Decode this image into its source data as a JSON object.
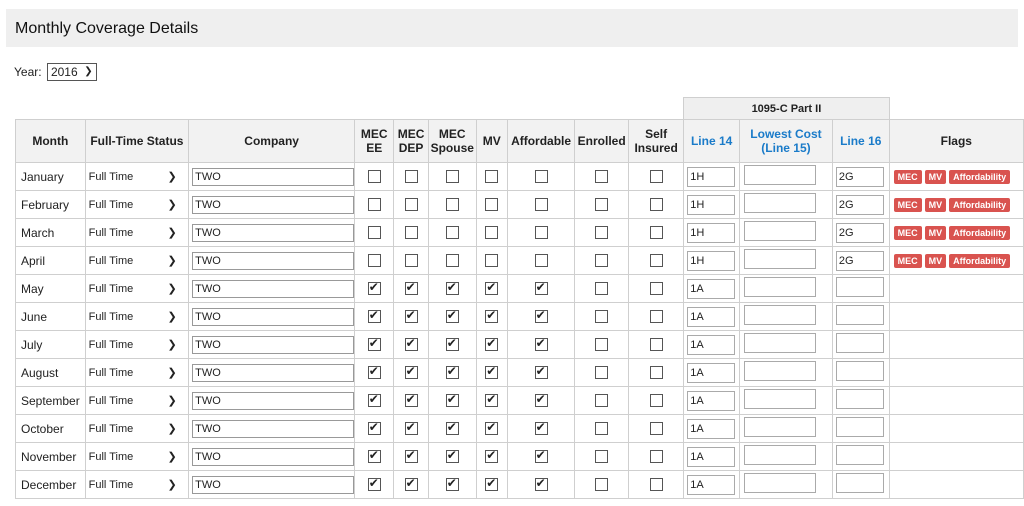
{
  "page": {
    "title": "Monthly Coverage Details"
  },
  "year": {
    "label": "Year:",
    "value": "2016"
  },
  "table": {
    "group_header": "1095-C Part II",
    "columns": {
      "month": "Month",
      "status": "Full-Time Status",
      "company": "Company",
      "mec_ee": "MEC EE",
      "mec_dep": "MEC DEP",
      "mec_spouse": "MEC Spouse",
      "mv": "MV",
      "affordable": "Affordable",
      "enrolled": "Enrolled",
      "self_insured": "Self Insured",
      "line14": "Line 14",
      "line15": "Lowest Cost (Line 15)",
      "line16": "Line 16",
      "flags": "Flags"
    },
    "rows": [
      {
        "month": "January",
        "status": "Full Time",
        "company": "TWO",
        "mec_ee": false,
        "mec_dep": false,
        "mec_spouse": false,
        "mv": false,
        "affordable": false,
        "enrolled": false,
        "self_insured": false,
        "line14": "1H",
        "line15": "",
        "line16": "2G",
        "flags": [
          "MEC",
          "MV",
          "Affordability"
        ]
      },
      {
        "month": "February",
        "status": "Full Time",
        "company": "TWO",
        "mec_ee": false,
        "mec_dep": false,
        "mec_spouse": false,
        "mv": false,
        "affordable": false,
        "enrolled": false,
        "self_insured": false,
        "line14": "1H",
        "line15": "",
        "line16": "2G",
        "flags": [
          "MEC",
          "MV",
          "Affordability"
        ]
      },
      {
        "month": "March",
        "status": "Full Time",
        "company": "TWO",
        "mec_ee": false,
        "mec_dep": false,
        "mec_spouse": false,
        "mv": false,
        "affordable": false,
        "enrolled": false,
        "self_insured": false,
        "line14": "1H",
        "line15": "",
        "line16": "2G",
        "flags": [
          "MEC",
          "MV",
          "Affordability"
        ]
      },
      {
        "month": "April",
        "status": "Full Time",
        "company": "TWO",
        "mec_ee": false,
        "mec_dep": false,
        "mec_spouse": false,
        "mv": false,
        "affordable": false,
        "enrolled": false,
        "self_insured": false,
        "line14": "1H",
        "line15": "",
        "line16": "2G",
        "flags": [
          "MEC",
          "MV",
          "Affordability"
        ]
      },
      {
        "month": "May",
        "status": "Full Time",
        "company": "TWO",
        "mec_ee": true,
        "mec_dep": true,
        "mec_spouse": true,
        "mv": true,
        "affordable": true,
        "enrolled": false,
        "self_insured": false,
        "line14": "1A",
        "line15": "",
        "line16": "",
        "flags": []
      },
      {
        "month": "June",
        "status": "Full Time",
        "company": "TWO",
        "mec_ee": true,
        "mec_dep": true,
        "mec_spouse": true,
        "mv": true,
        "affordable": true,
        "enrolled": false,
        "self_insured": false,
        "line14": "1A",
        "line15": "",
        "line16": "",
        "flags": []
      },
      {
        "month": "July",
        "status": "Full Time",
        "company": "TWO",
        "mec_ee": true,
        "mec_dep": true,
        "mec_spouse": true,
        "mv": true,
        "affordable": true,
        "enrolled": false,
        "self_insured": false,
        "line14": "1A",
        "line15": "",
        "line16": "",
        "flags": []
      },
      {
        "month": "August",
        "status": "Full Time",
        "company": "TWO",
        "mec_ee": true,
        "mec_dep": true,
        "mec_spouse": true,
        "mv": true,
        "affordable": true,
        "enrolled": false,
        "self_insured": false,
        "line14": "1A",
        "line15": "",
        "line16": "",
        "flags": []
      },
      {
        "month": "September",
        "status": "Full Time",
        "company": "TWO",
        "mec_ee": true,
        "mec_dep": true,
        "mec_spouse": true,
        "mv": true,
        "affordable": true,
        "enrolled": false,
        "self_insured": false,
        "line14": "1A",
        "line15": "",
        "line16": "",
        "flags": []
      },
      {
        "month": "October",
        "status": "Full Time",
        "company": "TWO",
        "mec_ee": true,
        "mec_dep": true,
        "mec_spouse": true,
        "mv": true,
        "affordable": true,
        "enrolled": false,
        "self_insured": false,
        "line14": "1A",
        "line15": "",
        "line16": "",
        "flags": []
      },
      {
        "month": "November",
        "status": "Full Time",
        "company": "TWO",
        "mec_ee": true,
        "mec_dep": true,
        "mec_spouse": true,
        "mv": true,
        "affordable": true,
        "enrolled": false,
        "self_insured": false,
        "line14": "1A",
        "line15": "",
        "line16": "",
        "flags": []
      },
      {
        "month": "December",
        "status": "Full Time",
        "company": "TWO",
        "mec_ee": true,
        "mec_dep": true,
        "mec_spouse": true,
        "mv": true,
        "affordable": true,
        "enrolled": false,
        "self_insured": false,
        "line14": "1A",
        "line15": "",
        "line16": "",
        "flags": []
      }
    ]
  },
  "colors": {
    "link_blue": "#1a7bc9",
    "flag_red": "#d9534f",
    "header_gray": "#efefef"
  },
  "icons": {
    "dropdown": "chevron-down-icon",
    "checked": "check-icon"
  }
}
